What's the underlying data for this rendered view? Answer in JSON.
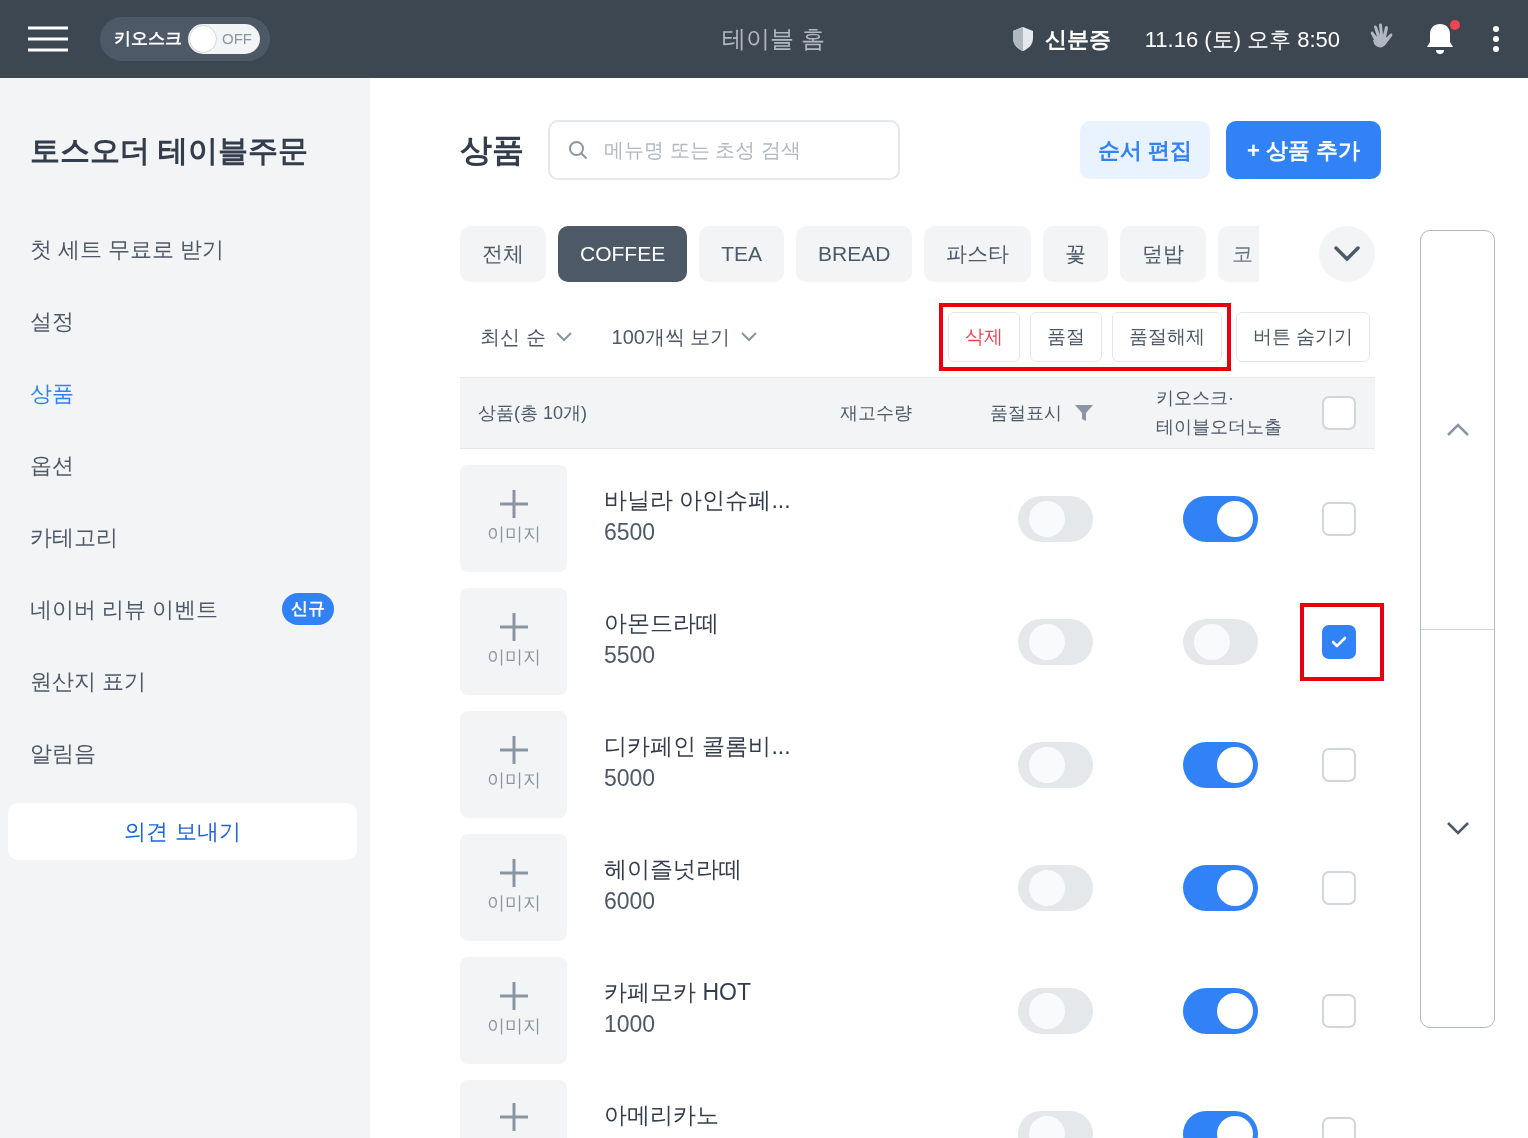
{
  "top_bar": {
    "kiosk_label": "키오스크",
    "kiosk_toggle": {
      "label": "OFF",
      "on": false
    },
    "title": "테이블 홈",
    "id_label": "신분증",
    "datetime": "11.16 (토) 오후 8:50",
    "notification_dot": true
  },
  "sidebar": {
    "title": "토스오더 테이블주문",
    "items": [
      {
        "label": "첫 세트 무료로 받기",
        "selected": false
      },
      {
        "label": "설정",
        "selected": false
      },
      {
        "label": "상품",
        "selected": true
      },
      {
        "label": "옵션",
        "selected": false
      },
      {
        "label": "카테고리",
        "selected": false
      },
      {
        "label": "네이버 리뷰 이벤트",
        "selected": false,
        "badge": "신규"
      },
      {
        "label": "원산지 표기",
        "selected": false
      },
      {
        "label": "알림음",
        "selected": false
      }
    ],
    "feedback_button": "의견 보내기"
  },
  "main": {
    "title": "상품",
    "search": {
      "placeholder": "메뉴명 또는 초성 검색"
    },
    "buttons": [
      {
        "label": "순서 편집",
        "kind": "secondary"
      },
      {
        "label": "+ 상품 추가",
        "kind": "primary"
      }
    ],
    "categories": [
      {
        "label": "전체",
        "selected": false
      },
      {
        "label": "COFFEE",
        "selected": true
      },
      {
        "label": "TEA",
        "selected": false
      },
      {
        "label": "BREAD",
        "selected": false
      },
      {
        "label": "파스타",
        "selected": false
      },
      {
        "label": "꽃",
        "selected": false
      },
      {
        "label": "덮밥",
        "selected": false
      },
      {
        "label": "코",
        "selected": false
      }
    ],
    "sort": "최신 순",
    "page_size": "100개씩 보기",
    "actions": [
      {
        "label": "삭제",
        "kind": "danger",
        "highlighted": true
      },
      {
        "label": "품절",
        "kind": "normal",
        "highlighted": true
      },
      {
        "label": "품절해제",
        "kind": "normal",
        "highlighted": true
      },
      {
        "label": "버튼 숨기기",
        "kind": "normal",
        "highlighted": false
      }
    ],
    "table": {
      "columns": [
        "상품(총 10개)",
        "재고수량",
        "품절표시",
        "키오스크·\n테이블오더노출"
      ],
      "select_all": {
        "checked": false
      },
      "rows": [
        {
          "image_label": "이미지",
          "name": "바닐라 아인슈페...",
          "price": "6500",
          "sold_out": false,
          "exposed": true,
          "checked": false,
          "highlighted": false
        },
        {
          "image_label": "이미지",
          "name": "아몬드라떼",
          "price": "5500",
          "sold_out": false,
          "exposed": false,
          "checked": true,
          "highlighted": true
        },
        {
          "image_label": "이미지",
          "name": "디카페인 콜롬비...",
          "price": "5000",
          "sold_out": false,
          "exposed": true,
          "checked": false,
          "highlighted": false
        },
        {
          "image_label": "이미지",
          "name": "헤이즐넛라떼",
          "price": "6000",
          "sold_out": false,
          "exposed": true,
          "checked": false,
          "highlighted": false
        },
        {
          "image_label": "이미지",
          "name": "카페모카 HOT",
          "price": "1000",
          "sold_out": false,
          "exposed": true,
          "checked": false,
          "highlighted": false
        },
        {
          "name": "아메리카노",
          "sold_out": false,
          "exposed": true,
          "checked": false,
          "highlighted": false
        }
      ]
    }
  }
}
